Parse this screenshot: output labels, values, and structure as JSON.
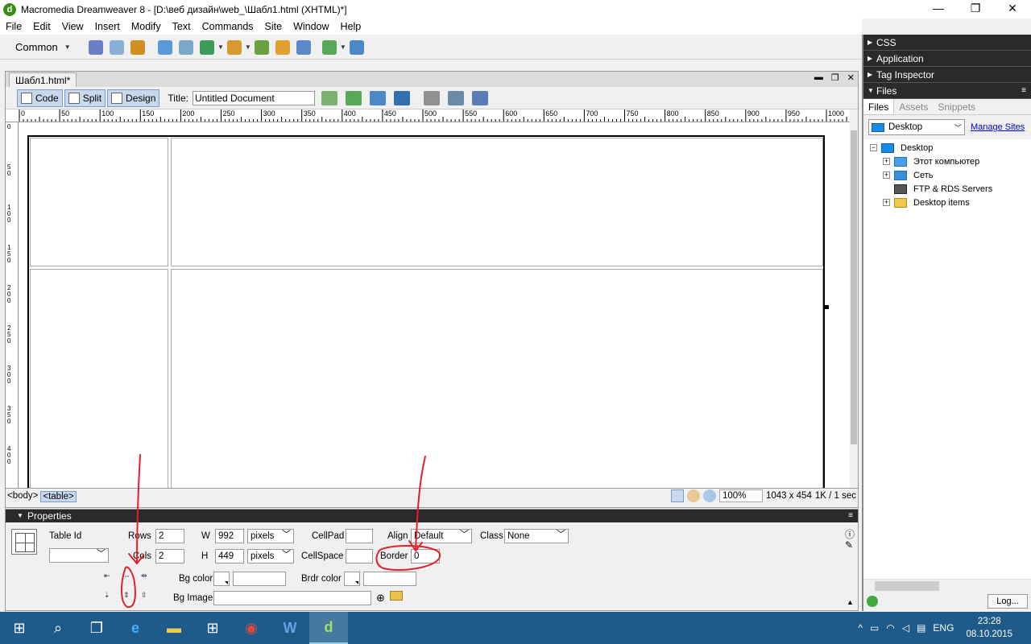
{
  "window": {
    "title": "Macromedia Dreamweaver 8 - [D:\\веб дизайн\\web_\\Шабл1.html (XHTML)*]",
    "minimize": "—",
    "restore": "❐",
    "close": "✕"
  },
  "menu": [
    "File",
    "Edit",
    "View",
    "Insert",
    "Modify",
    "Text",
    "Commands",
    "Site",
    "Window",
    "Help"
  ],
  "insert_toolbar": {
    "category": "Common"
  },
  "document": {
    "tab": "Шабл1.html*",
    "views": {
      "code": "Code",
      "split": "Split",
      "design": "Design"
    },
    "title_label": "Title:",
    "title_value": "Untitled Document",
    "ruler_marks": [
      "0",
      "50",
      "100",
      "150",
      "200",
      "250",
      "300",
      "350",
      "400",
      "450",
      "500",
      "550",
      "600",
      "650",
      "700",
      "750",
      "800",
      "850",
      "900",
      "950",
      "1000"
    ],
    "vruler_marks": [
      "0",
      "50",
      "100",
      "150",
      "200",
      "250",
      "300",
      "350",
      "400"
    ]
  },
  "statusbar": {
    "tag_body": "<body>",
    "tag_table": "<table>",
    "zoom": "100%",
    "size": "1043 x 454",
    "download": "1K / 1 sec"
  },
  "properties": {
    "header": "Properties",
    "table_id_label": "Table Id",
    "rows_label": "Rows",
    "rows": "2",
    "cols_label": "Cols",
    "cols": "2",
    "w_label": "W",
    "w": "992",
    "w_unit": "pixels",
    "h_label": "H",
    "h": "449",
    "h_unit": "pixels",
    "cellpad_label": "CellPad",
    "cellpad": "",
    "cellspace_label": "CellSpace",
    "cellspace": "",
    "align_label": "Align",
    "align": "Default",
    "border_label": "Border",
    "border": "0",
    "class_label": "Class",
    "class": "None",
    "bgcolor_label": "Bg color",
    "brdrcolor_label": "Brdr color",
    "bgimage_label": "Bg Image"
  },
  "panels": {
    "css": "CSS",
    "application": "Application",
    "tag_inspector": "Tag Inspector",
    "files": "Files",
    "tabs": [
      "Files",
      "Assets",
      "Snippets"
    ],
    "site": "Desktop",
    "manage_sites": "Manage Sites",
    "tree": [
      {
        "label": "Desktop",
        "level": 0,
        "expander": "−"
      },
      {
        "label": "Этот компьютер",
        "level": 1,
        "expander": "+"
      },
      {
        "label": "Сеть",
        "level": 1,
        "expander": "+"
      },
      {
        "label": "FTP & RDS Servers",
        "level": 1,
        "expander": ""
      },
      {
        "label": "Desktop items",
        "level": 1,
        "expander": "+"
      }
    ],
    "log_button": "Log..."
  },
  "taskbar": {
    "lang": "ENG",
    "time": "23:28",
    "date": "08.10.2015"
  },
  "colors": {
    "annotation": "#e0202a",
    "panel_header": "#2a2a2a",
    "taskbar": "#1f5b8a",
    "selected_view": "#c8d8ec"
  }
}
